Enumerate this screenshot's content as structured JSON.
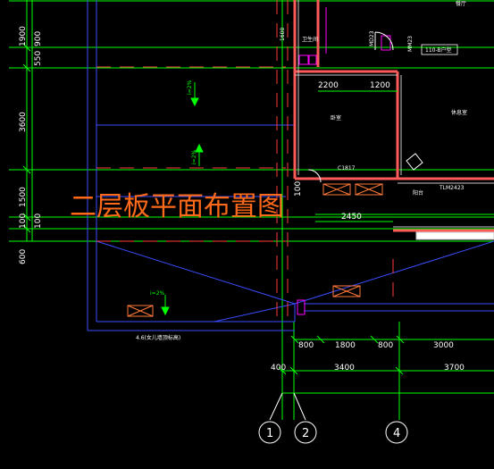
{
  "drawing_title": "二层板平面布置图",
  "colors": {
    "background": "#000000",
    "grid": "#00ff00",
    "wall": "#ff3b3b",
    "structure": "#3a4dff",
    "title": "#ff6a1a",
    "dimension": "#ffffff",
    "hatch": "#ff7a3a",
    "accent": "#ff00ff"
  },
  "dims_bottom": {
    "row1": [
      "800",
      "1800",
      "800",
      "3000"
    ],
    "row2": [
      "400",
      "3400",
      "3700"
    ]
  },
  "dims_left": [
    "1900",
    "900",
    "550",
    "3600",
    "1500",
    "100",
    "100",
    "600"
  ],
  "dims_inner": [
    "2200",
    "1200",
    "2450",
    "100"
  ],
  "axes": [
    "1",
    "2",
    "4"
  ],
  "labels": {
    "room_a": "卫生间",
    "room_b": "卧室",
    "room_c": "休息室",
    "room_d": "阳台",
    "window": "TLM2423",
    "door": "C1817",
    "top_right": "餐厅",
    "tag": "110-B户型",
    "ref": "MM23",
    "note_elev": "4.6(女儿墙顶标高)",
    "slope1": "i=2%",
    "slope2": "i=2%",
    "slope3": "i=2%",
    "dim_1600": "1600",
    "dim_2023": "MD23"
  }
}
